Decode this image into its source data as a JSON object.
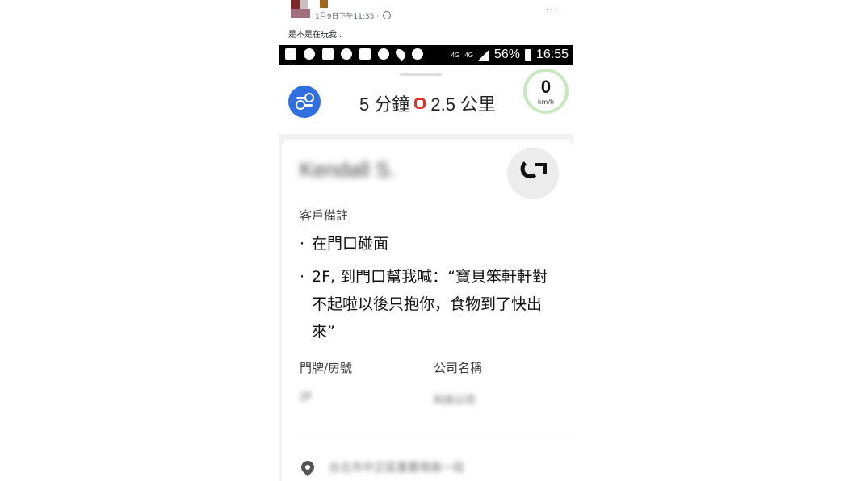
{
  "post": {
    "meta": "1月9日下午11:35 · ",
    "more": "...",
    "caption": "是不是在玩我.."
  },
  "statusbar": {
    "network": "4G",
    "network2": "4G",
    "battery": "56%",
    "time": "16:55"
  },
  "topbar": {
    "eta": "5 分鐘",
    "distance": "2.5 公里",
    "speed": "0",
    "speed_unit": "km/h",
    "accent_color": "#2f6fe0"
  },
  "order": {
    "customer_name": "Kendall S.",
    "notes_label": "客戶備註",
    "bullet": "·",
    "notes": [
      "在門口碰面",
      "2F, 到門口幫我喊：“寶貝笨軒軒對不起啦以後只抱你，食物到了快出來”"
    ],
    "door_label": "門牌/房號",
    "door_value": "2F",
    "company_label": "公司名稱",
    "company_value": "科技公司",
    "address": "台北市中正區重慶南路一段"
  }
}
